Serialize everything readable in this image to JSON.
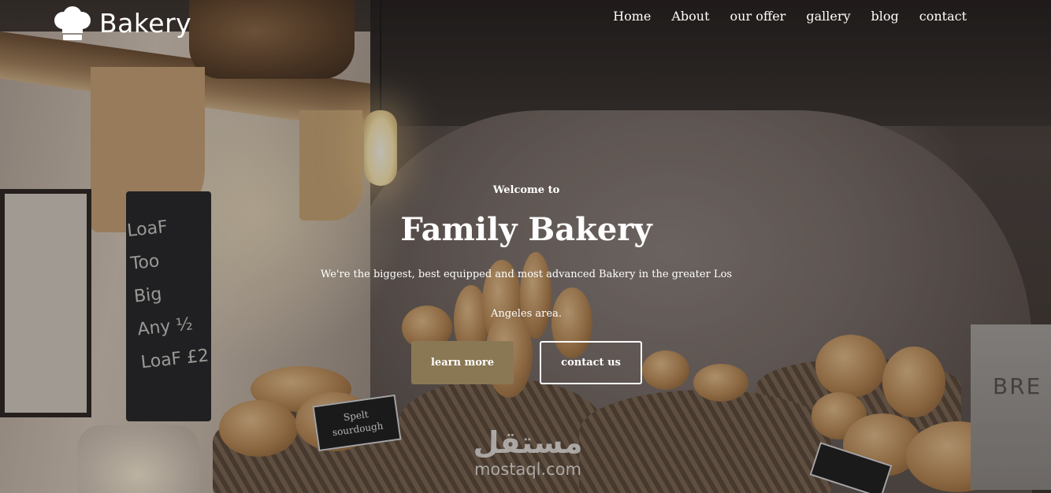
{
  "brand": {
    "name": "Bakery",
    "icon": "chef-hat-icon"
  },
  "nav": {
    "items": [
      {
        "label": "Home"
      },
      {
        "label": "About"
      },
      {
        "label": "our offer"
      },
      {
        "label": "gallery"
      },
      {
        "label": "blog"
      },
      {
        "label": "contact"
      }
    ]
  },
  "hero": {
    "welcome": "Welcome to",
    "title": "Family Bakery",
    "description": "We're the biggest, best equipped and most advanced Bakery in the greater Los Angeles area.",
    "buttons": {
      "primary": "learn more",
      "secondary": "contact us"
    }
  },
  "scene": {
    "chalkboard_text": [
      "LoaF Too",
      "Big",
      "Any ½",
      "LoaF £2"
    ],
    "bread_sign": [
      "Spelt",
      "sourdough"
    ],
    "tin_label": "BRE"
  },
  "watermark": {
    "arabic": "مستقل",
    "site": "mostaql.com"
  },
  "colors": {
    "primary_button": "#8a7855",
    "text": "#ffffff"
  }
}
